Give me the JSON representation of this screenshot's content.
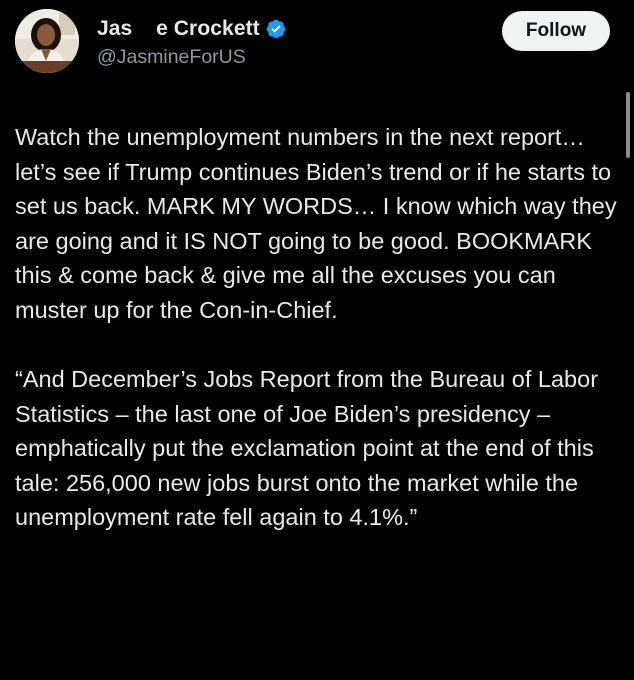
{
  "profile": {
    "display_name": "Jas    e Crockett",
    "handle": "@JasmineForUS",
    "verified": true
  },
  "follow_button": {
    "label": "Follow"
  },
  "tweet": {
    "paragraph_1": "Watch the unemployment numbers in the next report… let’s see if Trump continues Biden’s trend or if he starts to set us back. MARK MY WORDS… I know which way they are going and it IS NOT going to be good. BOOKMARK this & come back & give me all the excuses you can muster up for the Con-in-Chief.",
    "paragraph_2": "“And December’s Jobs Report from the Bureau of Labor Statistics – the last one of Joe Biden’s presidency – emphatically put the exclamation point at the end of this tale: 256,000 new jobs burst onto the market while the unemployment rate fell again to 4.1%.”"
  },
  "colors": {
    "background": "#000000",
    "text_primary": "#e7e9ea",
    "text_secondary": "#8b98a5",
    "verified_blue": "#1d9bf0",
    "follow_bg": "#eff3f4"
  },
  "icons": {
    "verified": "verified-badge-icon",
    "avatar": "profile-avatar"
  }
}
